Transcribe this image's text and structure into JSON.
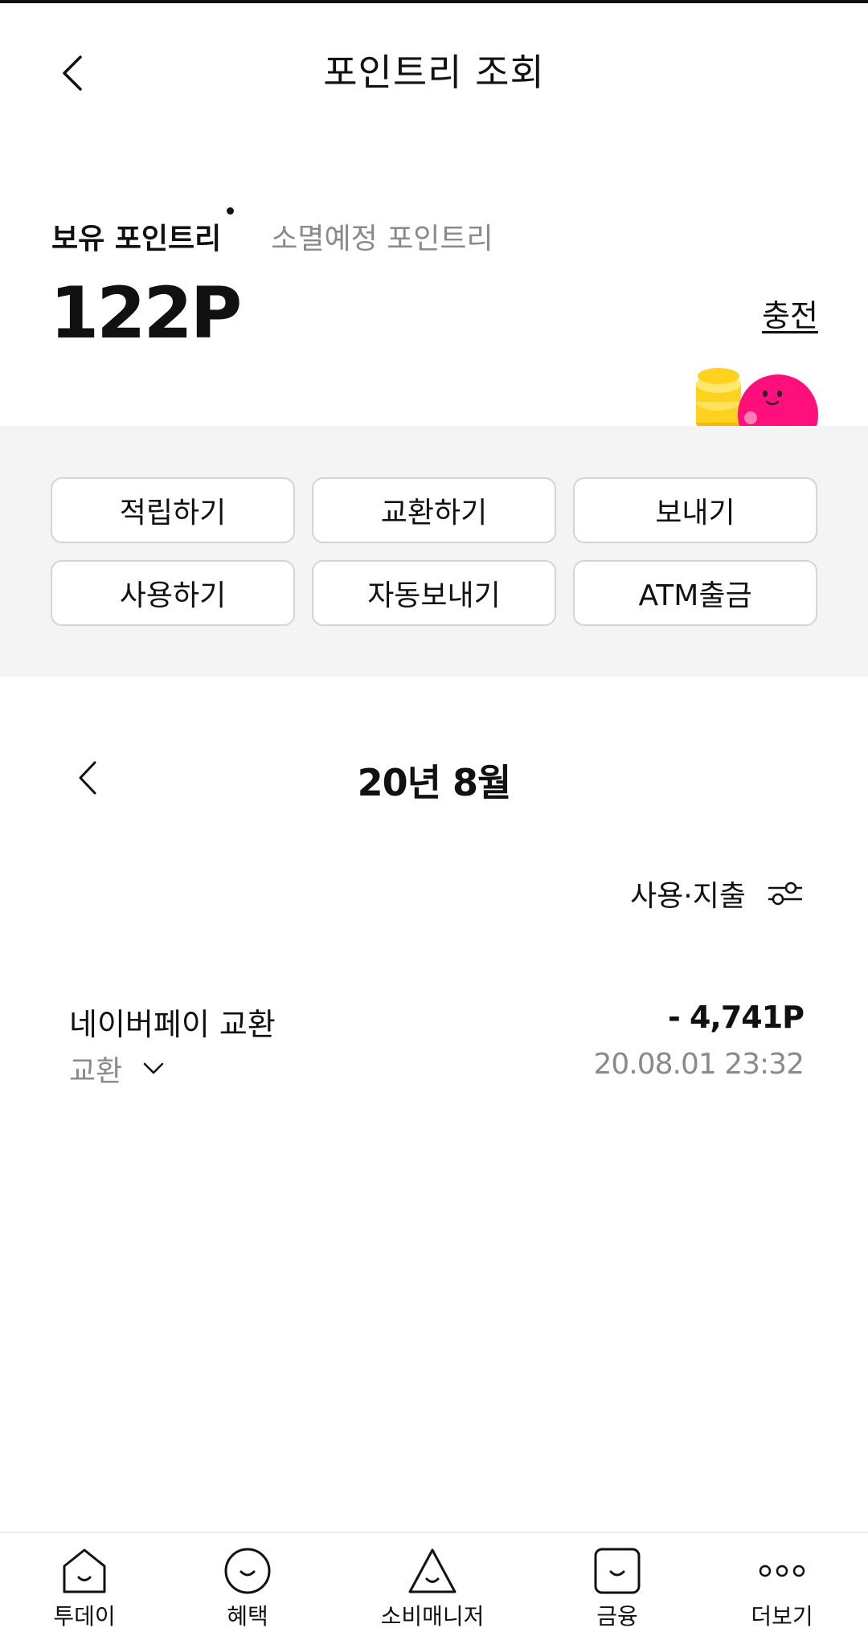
{
  "header": {
    "title": "포인트리 조회"
  },
  "balance": {
    "tab_active": "보유 포인트리",
    "tab_inactive": "소멸예정 포인트리",
    "amount": "122P",
    "charge_label": "충전"
  },
  "actions": {
    "earn": "적립하기",
    "exchange": "교환하기",
    "send": "보내기",
    "use": "사용하기",
    "auto_send": "자동보내기",
    "atm": "ATM출금"
  },
  "history": {
    "month_label": "20년 8월",
    "filter_label": "사용·지출",
    "transactions": [
      {
        "title": "네이버페이 교환",
        "category": "교환",
        "amount": "- 4,741P",
        "datetime": "20.08.01 23:32"
      }
    ]
  },
  "nav": {
    "today": "투데이",
    "benefits": "혜택",
    "consumption_manager": "소비매니저",
    "finance": "금융",
    "more": "더보기"
  },
  "colors": {
    "panel_bg": "#f4f4f4",
    "mascot_pink": "#ff0f7b",
    "coin_yellow": "#ffd21f",
    "muted_text": "#8a8a8a"
  },
  "icons": {
    "back": "chevron-left-icon",
    "filter": "filter-sliders-icon",
    "expand": "chevron-down-icon"
  }
}
